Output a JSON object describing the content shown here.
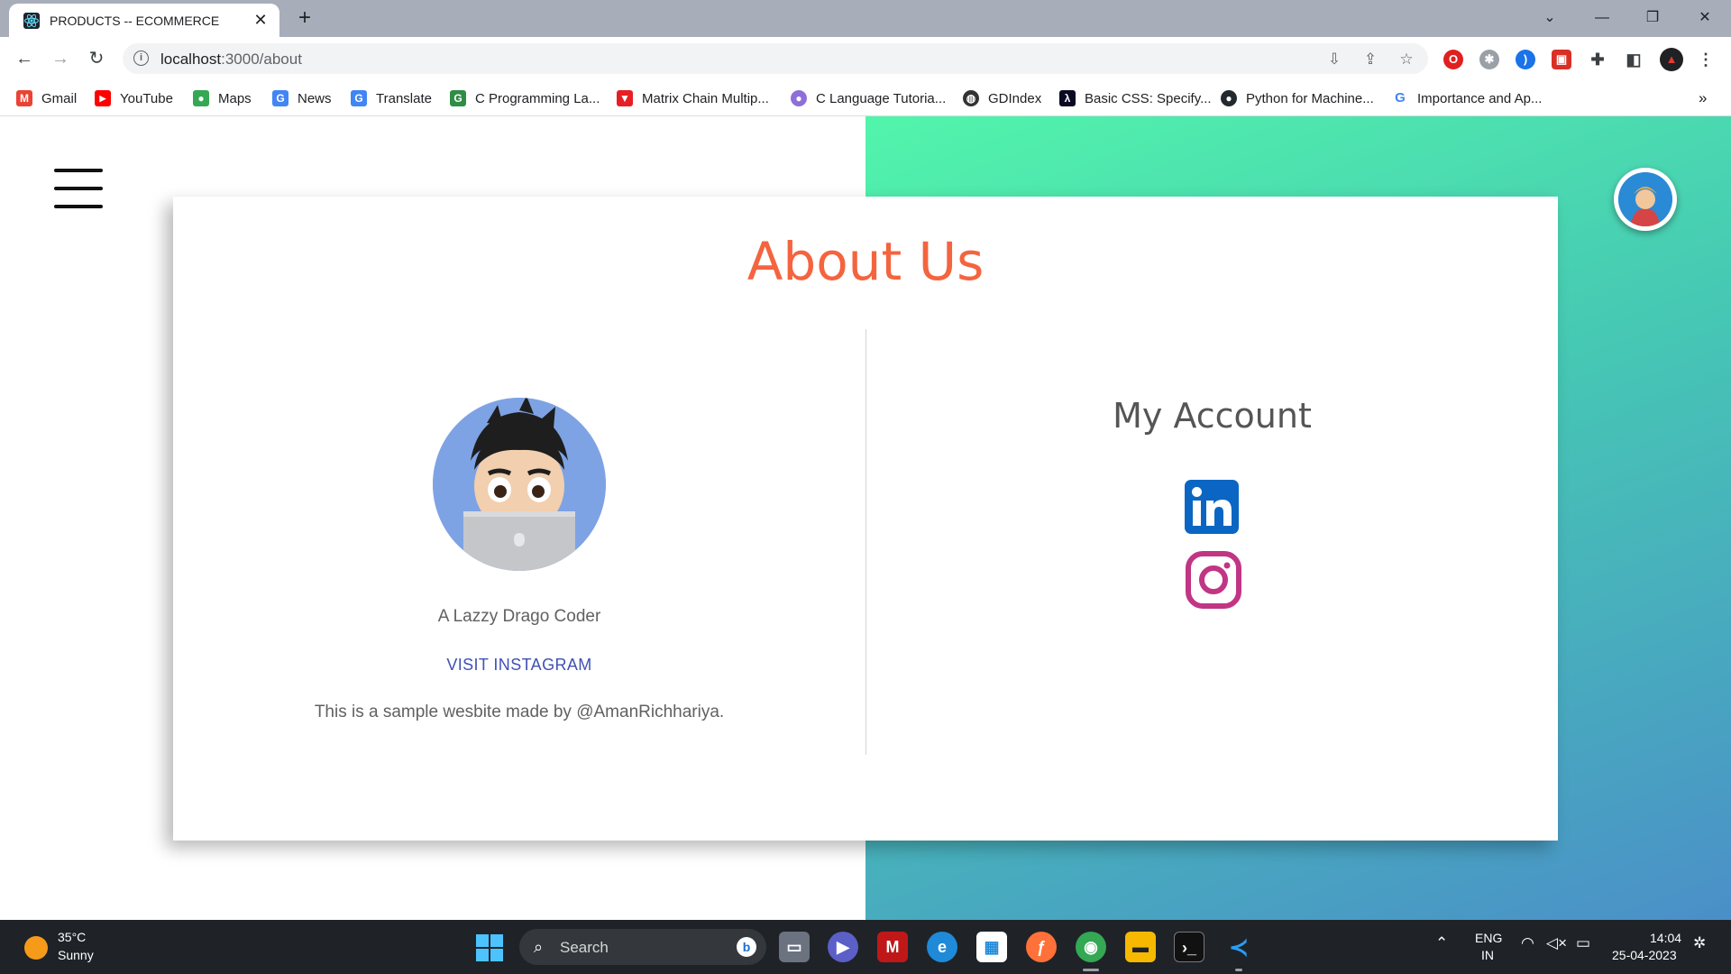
{
  "browser": {
    "tab_title": "PRODUCTS -- ECOMMERCE",
    "tab_close": "✕",
    "new_tab": "+",
    "url_host": "localhost",
    "url_path": ":3000/about",
    "window_controls": [
      "⌄",
      "—",
      "❐",
      "✕"
    ]
  },
  "bookmarks": [
    {
      "label": "Gmail",
      "icon": "gmail-icon",
      "color": "#ea4335",
      "glyph": "M"
    },
    {
      "label": "YouTube",
      "icon": "youtube-icon",
      "color": "#ff0000",
      "glyph": "▶"
    },
    {
      "label": "Maps",
      "icon": "maps-icon",
      "color": "#34a853",
      "glyph": "●"
    },
    {
      "label": "News",
      "icon": "news-icon",
      "color": "#4285f4",
      "glyph": "G"
    },
    {
      "label": "Translate",
      "icon": "translate-icon",
      "color": "#4285f4",
      "glyph": "G"
    },
    {
      "label": "C Programming La...",
      "icon": "geeksforgeeks-icon",
      "color": "#2f8d46",
      "glyph": "G"
    },
    {
      "label": "Matrix Chain Multip...",
      "icon": "tutorial-icon",
      "color": "#e81e25",
      "glyph": "▼"
    },
    {
      "label": "C Language Tutoria...",
      "icon": "person-icon",
      "color": "#8e6fd8",
      "glyph": "●"
    },
    {
      "label": "GDIndex",
      "icon": "globe-icon",
      "color": "#333333",
      "glyph": "◍"
    },
    {
      "label": "Basic CSS: Specify...",
      "icon": "freecodecamp-icon",
      "color": "#0a0a23",
      "glyph": "λ"
    },
    {
      "label": "Python for Machine...",
      "icon": "github-icon",
      "color": "#24292f",
      "glyph": "●"
    },
    {
      "label": "Importance and Ap...",
      "icon": "google-icon",
      "color": "#4285f4",
      "glyph": "G"
    }
  ],
  "bookmarks_overflow": "»",
  "page": {
    "title": "About Us",
    "coder_name": "A Lazzy Drago Coder",
    "visit_button": "VISIT INSTAGRAM",
    "about_text": "This is a sample wesbite made by @AmanRichhariya.",
    "account_title": "My Account",
    "linkedin_color": "#0a66c2",
    "instagram_color": "#c13584",
    "title_color": "#f4643f"
  },
  "taskbar": {
    "weather_temp": "35°C",
    "weather_desc": "Sunny",
    "search_label": "Search",
    "lang_top": "ENG",
    "lang_bottom": "IN",
    "time": "14:04",
    "date": "25-04-2023"
  }
}
